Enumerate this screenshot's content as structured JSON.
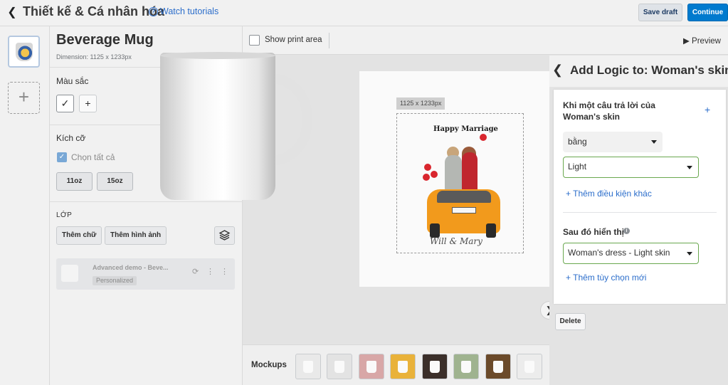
{
  "header": {
    "title": "Thiết kế & Cá nhân hóa",
    "tutorial_link": "Watch tutorials",
    "save_draft": "Save draft",
    "continue": "Continue"
  },
  "product": {
    "name": "Beverage Mug",
    "dimension": "Dimension: 1125 x 1233px"
  },
  "sidebar": {
    "color_section": "Màu sắc",
    "size_section": "Kích cỡ",
    "select_all": "Chọn tất cả",
    "sizes": [
      "11oz",
      "15oz"
    ],
    "layer_section": "LỚP",
    "add_text": "Thêm chữ",
    "add_image": "Thêm hình ảnh",
    "layer_name": "Advanced demo - Beve...",
    "layer_badge": "Personalized"
  },
  "canvas": {
    "show_print_area": "Show print area",
    "preview": "Preview",
    "print_dim": "1125 x 1233px",
    "mug_title": "Happy Marriage",
    "mug_script": "Will & Mary"
  },
  "mockups": {
    "label": "Mockups",
    "thumb_colors": [
      "#e9e9e9",
      "#e3e3e3",
      "#d8a7a7",
      "#e9b23a",
      "#3b2f2a",
      "#9fb38f",
      "#6b4a2a",
      "#ececec"
    ]
  },
  "logic": {
    "title": "Add Logic to: Woman's skin",
    "condition_text": "Khi một câu trả lời của Woman's skin",
    "operator": "bằng",
    "value": "Light",
    "add_condition": "Thêm điều kiện khác",
    "then_show": "Sau đó hiển thị",
    "result": "Woman's dress - Light skin",
    "add_option": "Thêm tùy chọn mới",
    "delete": "Delete"
  }
}
